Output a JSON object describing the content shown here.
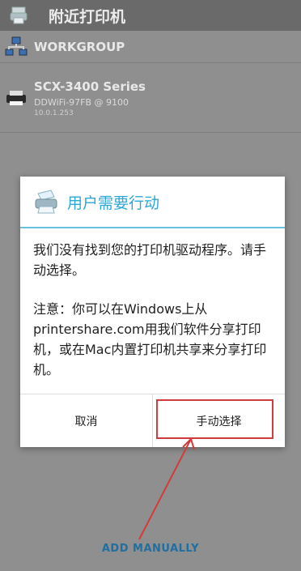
{
  "appbar": {
    "title": "附近打印机"
  },
  "printers": [
    {
      "name": "WORKGROUP"
    },
    {
      "name": "SCX-3400 Series",
      "detail": "DDWiFi-97FB @ 9100",
      "ip": "10.0.1.253"
    }
  ],
  "dialog": {
    "title": "用户需要行动",
    "message1": "我们没有找到您的打印机驱动程序。请手动选择。",
    "message2": "注意：你可以在Windows上从printershare.com用我们软件分享打印机，或在Mac内置打印机共享来分享打印机。",
    "cancel_label": "取消",
    "manual_label": "手动选择"
  },
  "footer": {
    "add_manually_label": "ADD MANUALLY"
  },
  "colors": {
    "accent": "#2ca7d7",
    "annotation": "#d23b3b"
  }
}
